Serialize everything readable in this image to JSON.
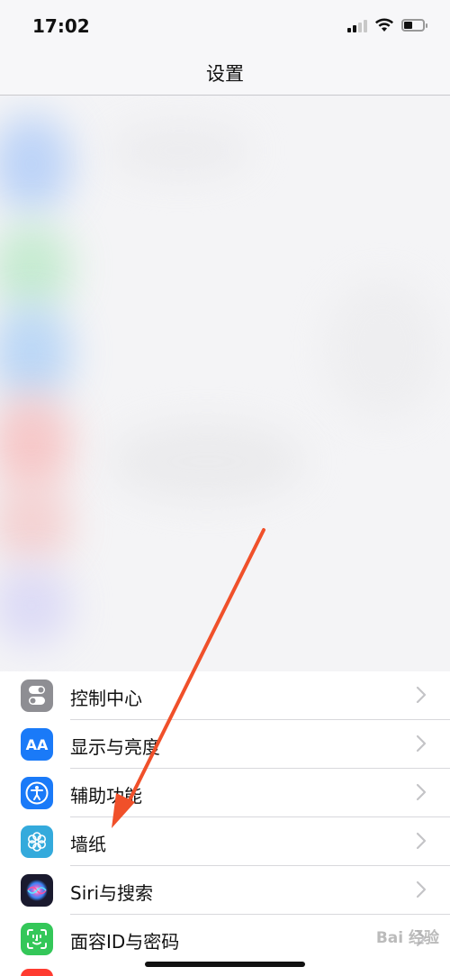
{
  "status_bar": {
    "time": "17:02",
    "icons": [
      "signal-icon",
      "wifi-icon",
      "battery-icon"
    ],
    "battery_level": 0.45
  },
  "nav": {
    "title": "设置"
  },
  "settings": {
    "items": [
      {
        "label": "控制中心",
        "icon": "control-center-icon",
        "color": "#8e8e93"
      },
      {
        "label": "显示与亮度",
        "icon": "display-brightness-icon",
        "icon_text": "AA",
        "color": "#1a7af8"
      },
      {
        "label": "辅助功能",
        "icon": "accessibility-icon",
        "color": "#1a7af8"
      },
      {
        "label": "墙纸",
        "icon": "wallpaper-icon",
        "color": "#34aadc"
      },
      {
        "label": "Siri与搜索",
        "icon": "siri-icon",
        "color": "#1a1a2e"
      },
      {
        "label": "面容ID与密码",
        "icon": "face-id-icon",
        "color": "#34c759"
      }
    ]
  },
  "annotation": {
    "color": "#f0502a"
  },
  "watermark": {
    "text": "Bai 经验"
  }
}
